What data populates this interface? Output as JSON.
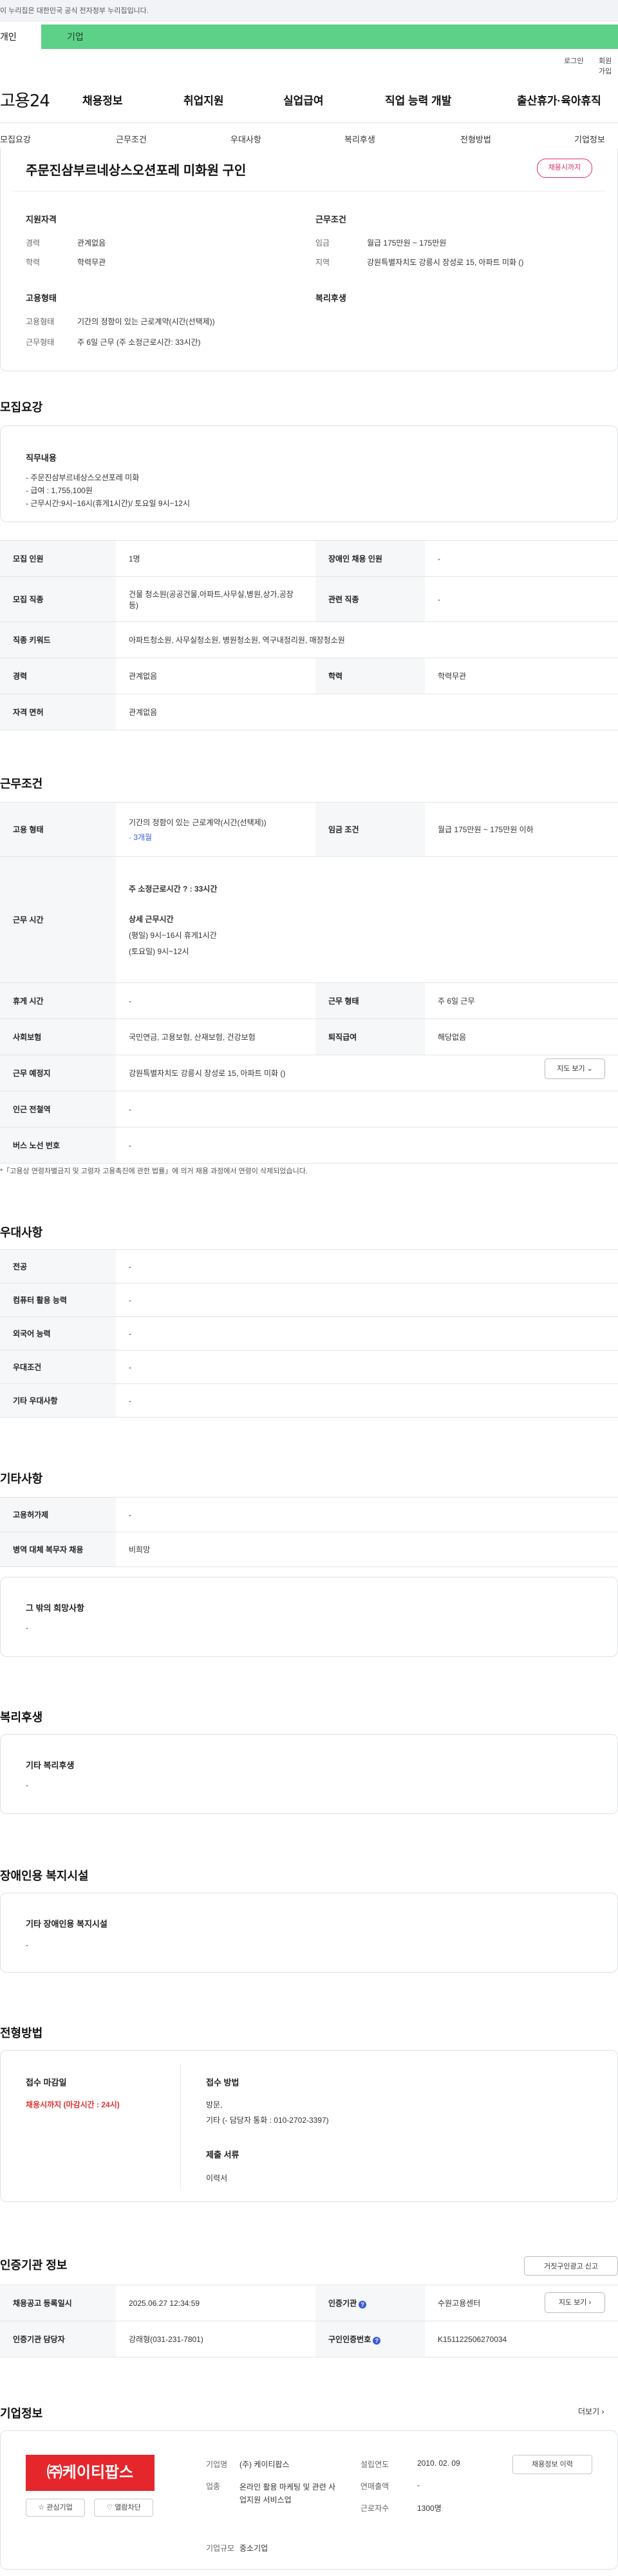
{
  "gov_banner": "이 누리집은 대한민국 공식 전자정부 누리집입니다.",
  "mode_tabs": {
    "individual": "개인",
    "corporate": "기업"
  },
  "util_links": {
    "login": "로그인",
    "signup": "회원가입"
  },
  "logo": "고용24",
  "gnb": [
    "채용정보",
    "취업지원",
    "실업급여",
    "직업 능력 개발",
    "출산휴가·육아휴직"
  ],
  "subnav": [
    "모집요강",
    "근무조건",
    "우대사항",
    "복리후생",
    "전형방법",
    "기업정보"
  ],
  "summary": {
    "title": "주문진삼부르네상스오션포레 미화원 구인",
    "badge": "채용시까지",
    "qual_title": "지원자격",
    "career_k": "경력",
    "career_v": "관계없음",
    "edu_k": "학력",
    "edu_v": "학력무관",
    "cond_title": "근무조건",
    "wage_k": "임금",
    "wage_v": "월급 175만원 ~ 175만원",
    "area_k": "지역",
    "area_v": "강원특별자치도 강릉시 장성로 15, 아파트 미화 ()",
    "emp_title": "고용형태",
    "emptype_k": "고용형태",
    "emptype_v": "기간의 정함이 있는 근로계약(시간(선택제))",
    "workform_k": "근무형태",
    "workform_v": "주 6일 근무 (주 소정근로시간: 33시간)",
    "welfare_title": "복리후생"
  },
  "recruit": {
    "title": "모집요강",
    "job_title": "직무내용",
    "job_lines": [
      "- 주문진삼부르네상스오션포레 미화",
      "- 급여 : 1,755,100원",
      "- 근무시간:9시~16시(휴게1시간)/ 토요일 9시~12시"
    ],
    "rows": [
      {
        "k1": "모집 인원",
        "v1": "1명",
        "k2": "장애인 채용 인원",
        "v2": "-"
      },
      {
        "k1": "모집 직종",
        "v1": "건물 청소원(공공건물,아파트,사무실,병원,상가,공장 등)",
        "k2": "관련 직종",
        "v2": "-"
      },
      {
        "k1": "직종 키워드",
        "v1": "아파트청소원, 사무실청소원, 병원청소원, 역구내정리원, 매장청소원"
      },
      {
        "k1": "경력",
        "v1": "관계없음",
        "k2": "학력",
        "v2": "학력무관"
      },
      {
        "k1": "자격 면허",
        "v1": "관계없음"
      }
    ]
  },
  "conditions": {
    "title": "근무조건",
    "emptype_k": "고용 형태",
    "emptype_v": "기간의 정함이 있는 근로계약(시간(선택제))",
    "emptype_sub": "· 3개월",
    "wage_k": "임금 조건",
    "wage_v": "월급 175만원 ~ 175만원 이하",
    "hours_k": "근무 시간",
    "hours_week": "주 소정근로시간 ? : 33시간",
    "hours_detail_title": "상세 근무시간",
    "hours_weekday": "(평일) 9시~16시 휴게1시간",
    "hours_sat": "(토요일) 9시~12시",
    "break_k": "휴게 시간",
    "break_v": "-",
    "form_k": "근무 형태",
    "form_v": "주 6일 근무",
    "ins_k": "사회보험",
    "ins_v": "국민연금, 고용보험, 산재보험, 건강보험",
    "sev_k": "퇴직급여",
    "sev_v": "해당없음",
    "place_k": "근무 예정지",
    "place_v": "강원특별자치도 강릉시 장성로 15, 아파트 미화 ()",
    "map_btn": "지도 보기 ⌄",
    "subway_k": "인근 전철역",
    "subway_v": "-",
    "bus_k": "버스 노선 번호",
    "bus_v": "-",
    "note": "*「고용상 연령차별금지 및 고령자 고용촉진에 관한 법률」에 의거 채용 과정에서 연령이 삭제되었습니다."
  },
  "preference": {
    "title": "우대사항",
    "rows": [
      {
        "k": "전공",
        "v": "-"
      },
      {
        "k": "컴퓨터 활용 능력",
        "v": "-"
      },
      {
        "k": "외국어 능력",
        "v": "-"
      },
      {
        "k": "우대조건",
        "v": "-"
      },
      {
        "k": "기타 우대사항",
        "v": "-"
      }
    ]
  },
  "etc": {
    "title": "기타사항",
    "rows": [
      {
        "k": "고용허가제",
        "v": "-"
      },
      {
        "k": "병역 대체 복무자 채용",
        "v": "비희망"
      }
    ],
    "other_title": "그 밖의 희망사항",
    "other_v": "-"
  },
  "welfare": {
    "title": "복리후생",
    "box_title": "기타 복리후생",
    "box_v": "-"
  },
  "disability": {
    "title": "장애인용 복지시설",
    "box_title": "기타 장애인용 복지시설",
    "box_v": "-"
  },
  "selection": {
    "title": "전형방법",
    "deadline_title": "접수 마감일",
    "deadline_v": "채용시까지 (마감시간 : 24시)",
    "method_title": "접수 방법",
    "method_v1": "방문,",
    "method_v2": "기타 (- 담당자 통화 : 010-2702-3397)",
    "docs_title": "제출 서류",
    "docs_v": "이력서"
  },
  "agency": {
    "title": "인증기관 정보",
    "report_btn": "거짓구인광고 신고",
    "reg_k": "채용공고 등록일시",
    "reg_v": "2025.06.27 12:34:59",
    "org_k": "인증기관",
    "org_v": "수원고용센터",
    "map_btn": "지도 보기 ›",
    "mgr_k": "인증기관 담당자",
    "mgr_v": "강래형(031-231-7801)",
    "no_k": "구인인증번호",
    "no_v": "K151122506270034"
  },
  "company": {
    "title": "기업정보",
    "more": "더보기 ›",
    "logo_text": "㈜케이티팝스",
    "fav_btn": "☆ 관심기업",
    "block_btn": "♡ 열람차단",
    "name_k": "기업명",
    "name_v": "(주) 케이티팝스",
    "est_k": "설립연도",
    "est_v": "2010. 02. 09",
    "ind_k": "업종",
    "ind_v": "온라인 활용 마케팅 및 관련 사업지원 서비스업",
    "sales_k": "연매출액",
    "sales_v": "-",
    "emp_k": "근로자수",
    "emp_v": "1300명",
    "scale_k": "기업규모",
    "scale_v": "중소기업",
    "info_btn": "채용정보 이력"
  }
}
